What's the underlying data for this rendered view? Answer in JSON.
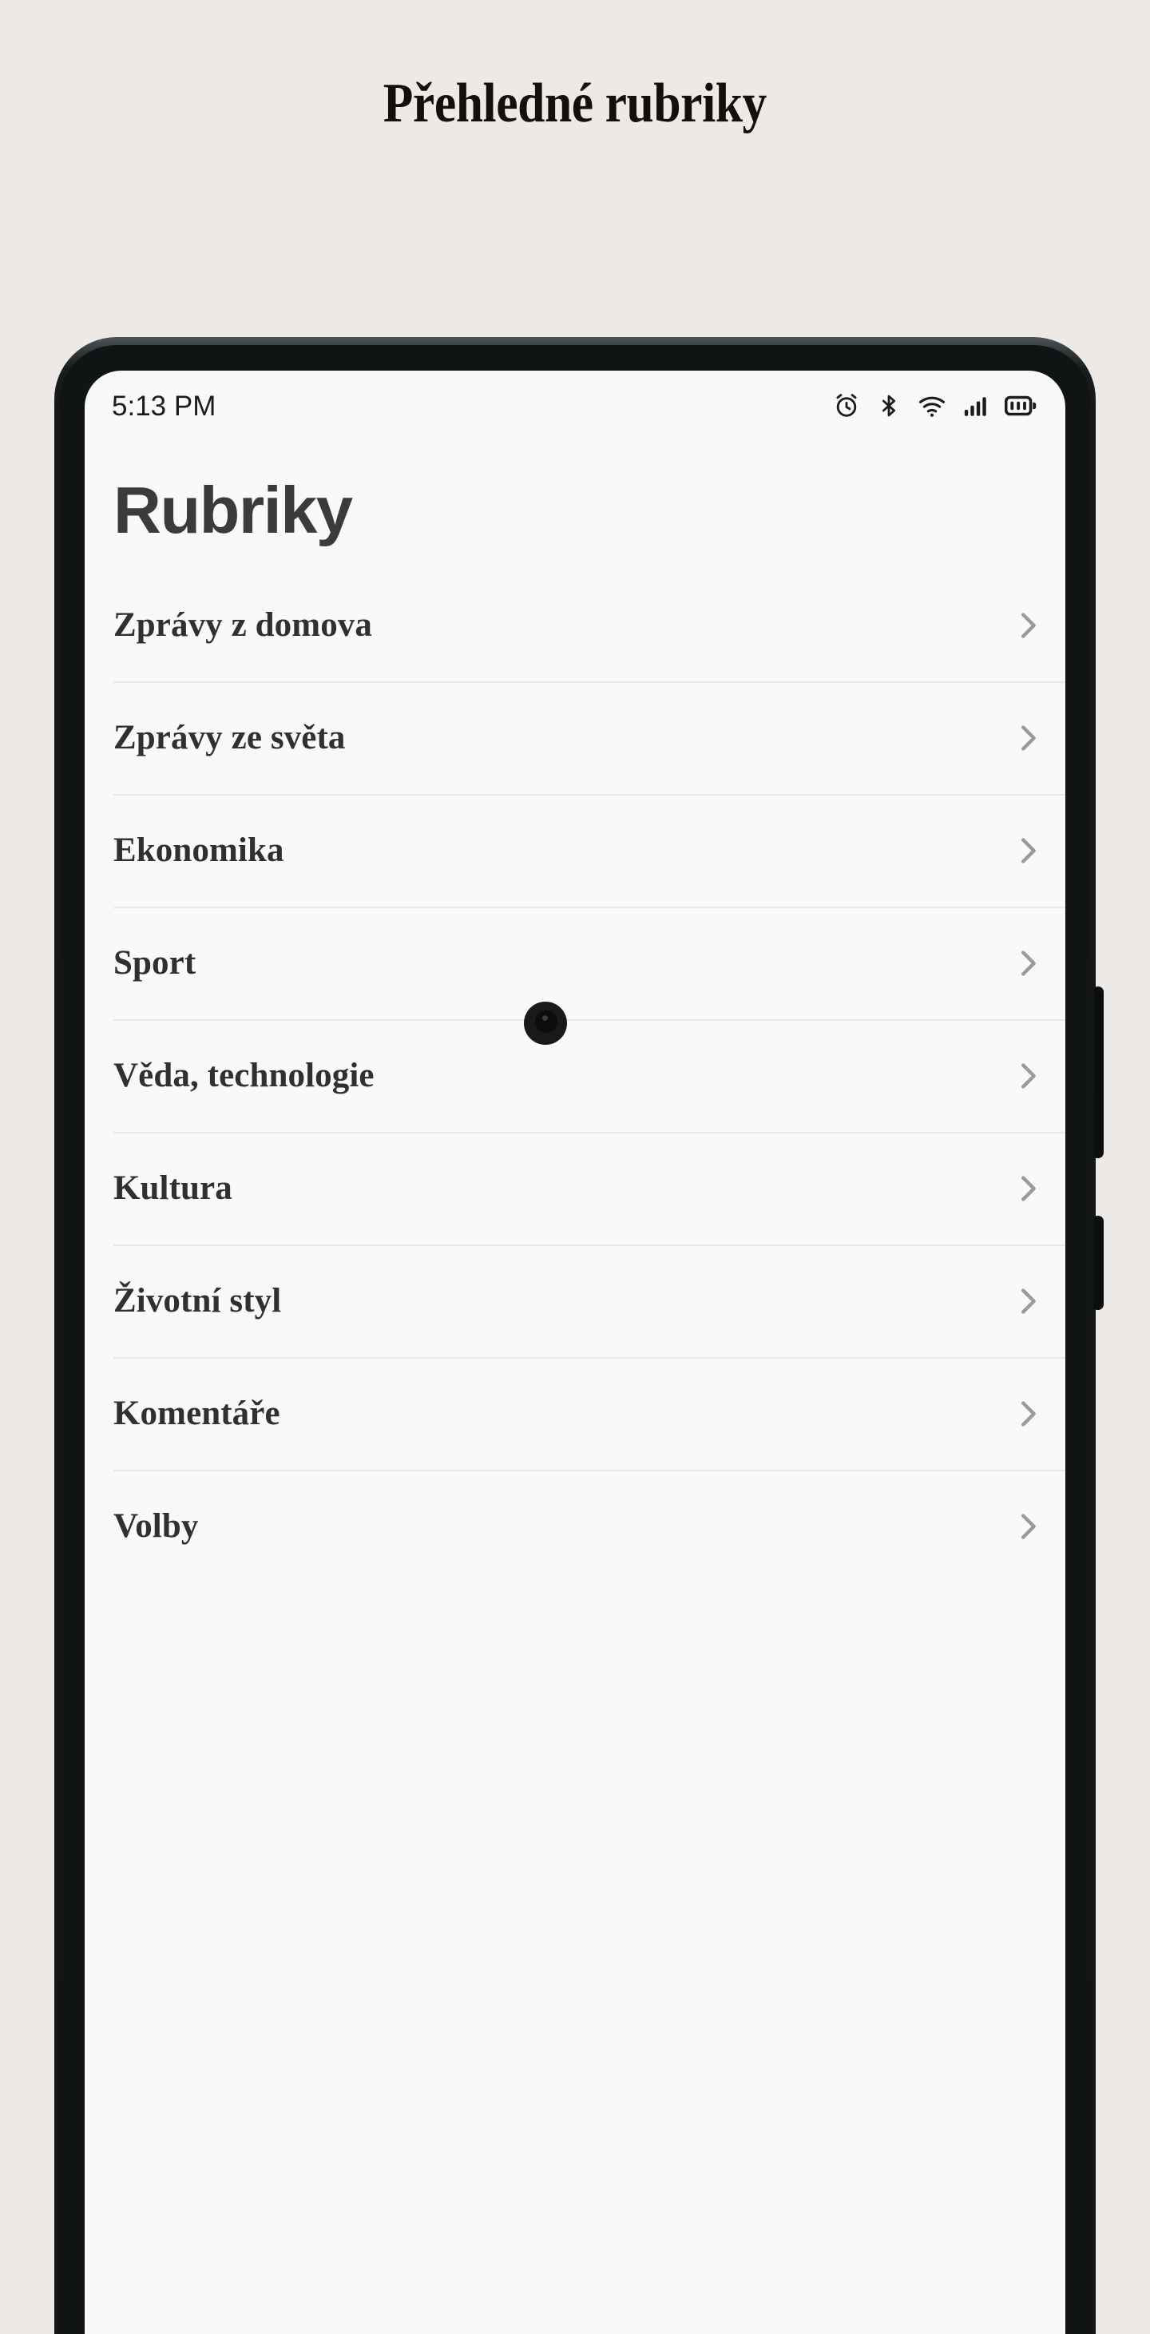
{
  "page": {
    "heading": "Přehledné rubriky",
    "background_color": "#ece9e6"
  },
  "phone": {
    "frame_color": "#121516",
    "screen_background": "#f9f9f9",
    "hardware": {
      "volume_button": "volume-rocker",
      "power_button": "power-button",
      "front_camera": "punch-hole-camera"
    }
  },
  "status_bar": {
    "time": "5:13 PM",
    "icons": [
      {
        "name": "alarm-icon"
      },
      {
        "name": "bluetooth-icon"
      },
      {
        "name": "wifi-icon"
      },
      {
        "name": "cellular-signal-icon"
      },
      {
        "name": "battery-icon"
      }
    ]
  },
  "app": {
    "title": "Rubriky",
    "title_color": "#3b3b3b",
    "divider_color": "#e8e8e8",
    "chevron_color": "#9a9a9a",
    "categories": [
      {
        "label": "Zprávy z domova"
      },
      {
        "label": "Zprávy ze světa"
      },
      {
        "label": "Ekonomika"
      },
      {
        "label": "Sport"
      },
      {
        "label": "Věda, technologie"
      },
      {
        "label": "Kultura"
      },
      {
        "label": "Životní styl"
      },
      {
        "label": "Komentáře"
      },
      {
        "label": "Volby"
      }
    ]
  }
}
